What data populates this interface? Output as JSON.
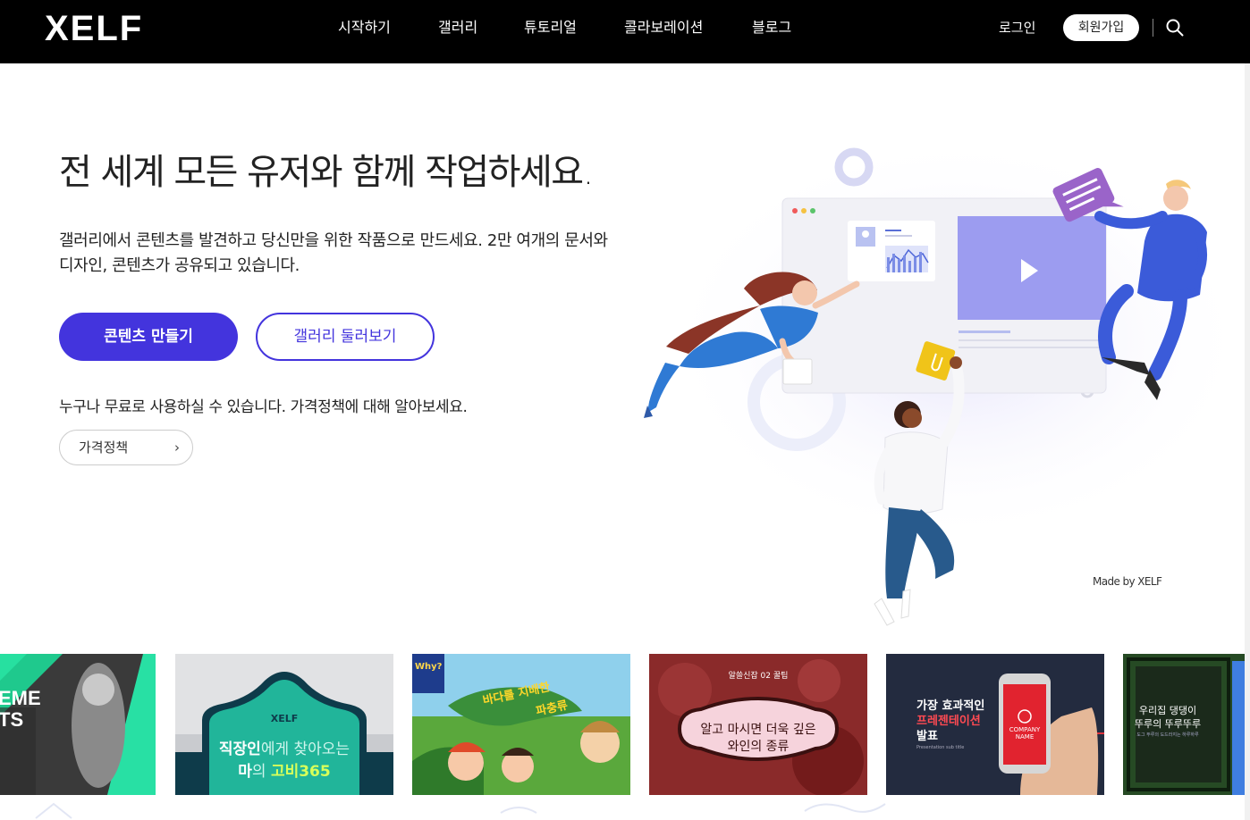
{
  "header": {
    "logo": "XELF",
    "nav": [
      "시작하기",
      "갤러리",
      "튜토리얼",
      "콜라보레이션",
      "블로그"
    ],
    "login": "로그인",
    "signup": "회원가입"
  },
  "hero": {
    "title": "전 세계 모든 유저와 함께 작업하세요.",
    "desc_line1": "갤러리에서 콘텐츠를 발견하고 당신만을 위한 작품으로 만드세요. 2만 여개의 문서와",
    "desc_line2": "디자인, 콘텐츠가 공유되고 있습니다.",
    "primary_button": "콘텐츠 만들기",
    "secondary_button": "갤러리 둘러보기",
    "free_note": "누구나 무료로 사용하실 수 있습니다. 가격정책에 대해 알아보세요.",
    "pricing_button": "가격정책",
    "made_by": "Made by XELF"
  },
  "gallery": {
    "card1_text_line1": "EME",
    "card1_text_line2": "TS",
    "card2_brand": "XELF",
    "card2_line1_bold": "직장인",
    "card2_line1_rest": "에게 찾아오는",
    "card2_line2_bold": "마",
    "card2_line2_mid": "의 ",
    "card2_line2_end": "고비365",
    "card3_badge": "Why?",
    "card3_title_1": "바다를 지배한",
    "card3_title_2": "파충류",
    "card4_top": "알쓸신잡 02 꿀팁",
    "card4_line1": "알고 마시면 더욱 깊은",
    "card4_line2": "와인의 종류",
    "card5_line1": "가장 효과적인",
    "card5_line2": "프레젠테이션",
    "card5_line3": "발표",
    "card5_sub": "Presentation sub title",
    "card5_phone_1": "COMPANY",
    "card5_phone_2": "NAME",
    "card6_line1": "우리집 댕댕이",
    "card6_line2": "뚜루의 뚜루뚜루",
    "card6_sub": "도그 뚜루의 도드라지는 하루하루"
  },
  "colors": {
    "primary": "#4334dd",
    "header_bg": "#000000",
    "illus_purple": "#9c9cf0",
    "illus_blue": "#3b5bd9",
    "illus_yellow": "#f0c419"
  },
  "icons": [
    "search-icon",
    "chevron-right-icon",
    "play-icon",
    "paperclip-icon",
    "message-icon"
  ]
}
